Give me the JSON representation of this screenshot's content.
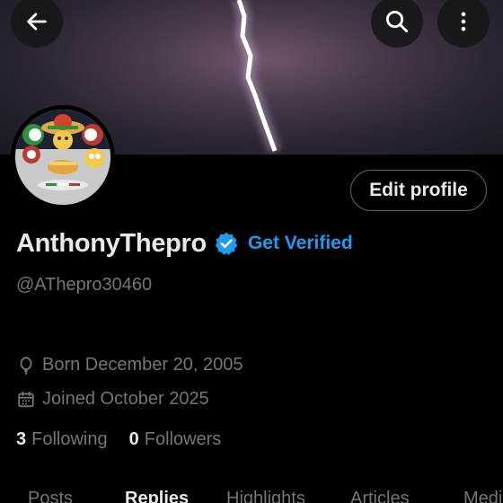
{
  "profile": {
    "display_name": "AnthonyThepro",
    "handle": "@AThepro30460",
    "get_verified_label": "Get Verified",
    "edit_profile_label": "Edit profile",
    "born_text": "Born December 20, 2005",
    "joined_text": "Joined October 2025",
    "following_count": "3",
    "following_label": "Following",
    "followers_count": "0",
    "followers_label": "Followers"
  },
  "tabs": [
    {
      "label": "Posts",
      "active": false
    },
    {
      "label": "Replies",
      "active": true
    },
    {
      "label": "Highlights",
      "active": false
    },
    {
      "label": "Articles",
      "active": false
    },
    {
      "label": "Media",
      "active": false
    }
  ],
  "icons": {
    "back": "arrow-left-icon",
    "search": "search-icon",
    "more": "more-vertical-icon",
    "verified": "verified-badge-icon",
    "birthday": "balloon-icon",
    "calendar": "calendar-icon"
  },
  "colors": {
    "background": "#000000",
    "accent": "#1d9bf0",
    "text_primary": "#e7e9ea",
    "text_secondary": "#71767b"
  }
}
